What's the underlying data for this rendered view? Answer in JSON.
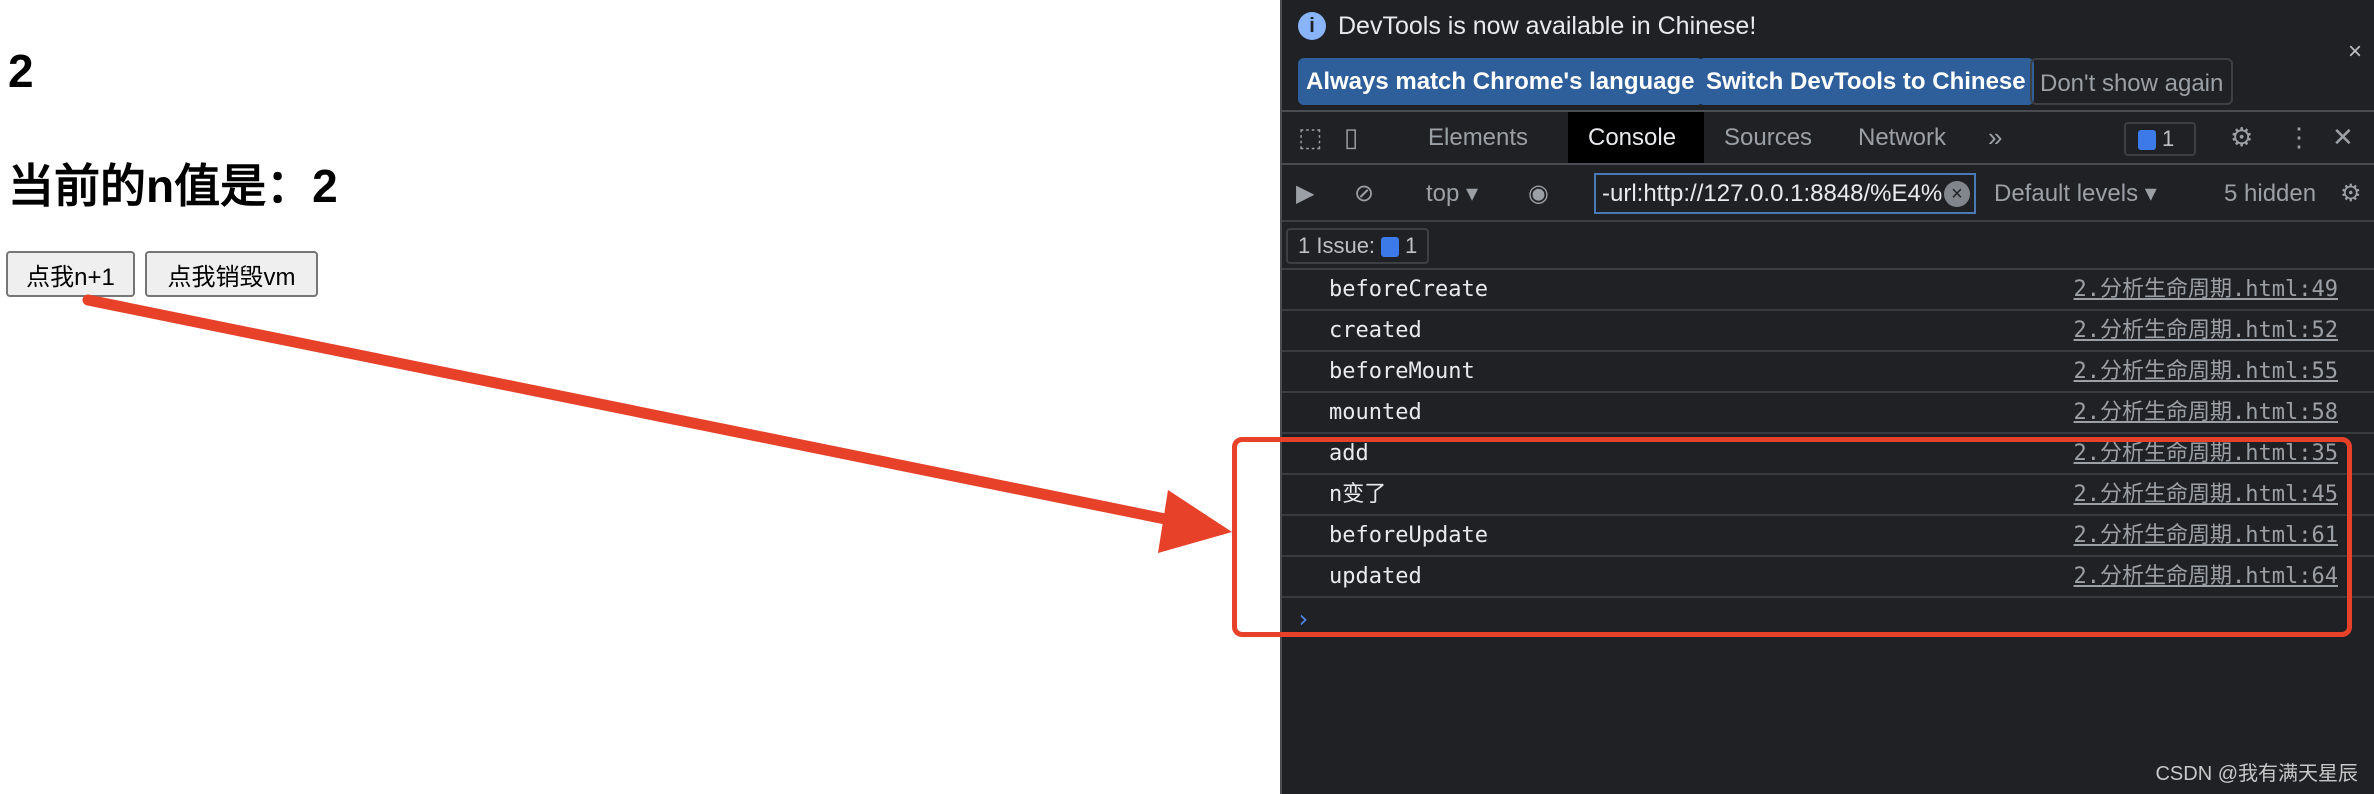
{
  "page": {
    "count": "2",
    "heading": "当前的n值是：2",
    "buttons": [
      "点我n+1",
      "点我销毁vm"
    ]
  },
  "devtools": {
    "infobar": {
      "message": "DevTools is now available in Chinese!",
      "buttons": [
        "Always match Chrome's language",
        "Switch DevTools to Chinese",
        "Don't show again"
      ],
      "close": "×"
    },
    "tabs": [
      "Elements",
      "Console",
      "Sources",
      "Network"
    ],
    "active_tab": "Console",
    "more": "»",
    "issue_badge": "1",
    "toolbar": {
      "context": "top ▾",
      "filter": "-url:http://127.0.0.1:8848/%E4%",
      "levels": "Default levels ▾",
      "hidden": "5 hidden"
    },
    "issues": {
      "label": "1 Issue:",
      "count": "1"
    },
    "logs": [
      {
        "msg": "beforeCreate",
        "src": "2.分析生命周期.html:49"
      },
      {
        "msg": "created",
        "src": "2.分析生命周期.html:52"
      },
      {
        "msg": "beforeMount",
        "src": "2.分析生命周期.html:55"
      },
      {
        "msg": "mounted",
        "src": "2.分析生命周期.html:58"
      },
      {
        "msg": "add",
        "src": "2.分析生命周期.html:35"
      },
      {
        "msg": "n变了",
        "src": "2.分析生命周期.html:45"
      },
      {
        "msg": "beforeUpdate",
        "src": "2.分析生命周期.html:61"
      },
      {
        "msg": "updated",
        "src": "2.分析生命周期.html:64"
      }
    ],
    "prompt": "›"
  },
  "watermark": "CSDN @我有满天星辰",
  "colors": {
    "annotation": "#e8412a",
    "accent": "#2f5f9a"
  }
}
